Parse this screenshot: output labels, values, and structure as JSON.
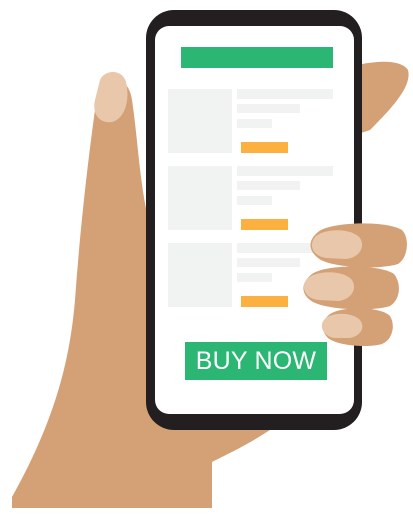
{
  "cta": {
    "label": "BUY NOW",
    "color": "#2bb673",
    "text_color": "#ffffff"
  },
  "colors": {
    "skin": "#d4a075",
    "skin_dark": "#c98f63",
    "nail": "#e9c7aa",
    "phone_body": "#231f20",
    "screen": "#ffffff",
    "header_bar": "#2bb673",
    "placeholder_gray": "#f1f2f2",
    "price_tag": "#fbb040"
  },
  "product_list": {
    "item_count": 3
  }
}
